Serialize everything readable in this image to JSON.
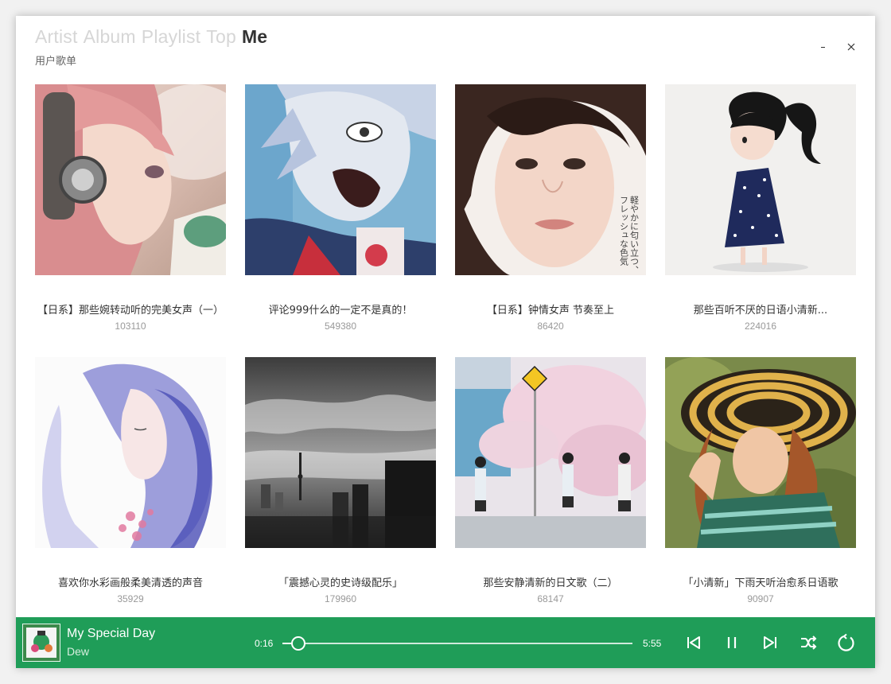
{
  "nav": {
    "tabs": [
      {
        "label": "Artist",
        "active": false
      },
      {
        "label": "Album",
        "active": false
      },
      {
        "label": "Playlist",
        "active": false
      },
      {
        "label": "Top",
        "active": false
      },
      {
        "label": "Me",
        "active": true
      }
    ],
    "subtitle": "用户歌单"
  },
  "window_controls": {
    "minimize_icon": "minimize-icon",
    "close_icon": "close-icon"
  },
  "playlists": [
    {
      "title": "【日系】那些婉转动听的完美女声（一）",
      "count": "103110",
      "cover": "anime-girl-headphones"
    },
    {
      "title": "评论999什么的一定不是真的！",
      "count": "549380",
      "cover": "anime-boy-shouting"
    },
    {
      "title": "【日系】钟情女声 节奏至上",
      "count": "86420",
      "cover": "woman-portrait"
    },
    {
      "title": "那些百听不厌的日语小清新...",
      "count": "224016",
      "cover": "little-girl-sketch"
    },
    {
      "title": "喜欢你水彩画般柔美清透的声音",
      "count": "35929",
      "cover": "watercolor-woman"
    },
    {
      "title": "「震撼心灵的史诗级配乐」",
      "count": "179960",
      "cover": "city-skyline-bw"
    },
    {
      "title": "那些安静清新的日文歌（二）",
      "count": "68147",
      "cover": "cherry-blossom-street"
    },
    {
      "title": "「小清新」下雨天听治愈系日语歌",
      "count": "90907",
      "cover": "woman-straw-hat"
    }
  ],
  "cover_text": {
    "vertical_caption": "軽やかに匂い立つ、フレッシュな色気"
  },
  "player": {
    "title": "My Special Day",
    "artist": "Dew",
    "current_time": "0:16",
    "total_time": "5:55",
    "progress": 0.045,
    "accent_color": "#1f9d58",
    "icons": [
      "prev-icon",
      "pause-icon",
      "next-icon",
      "shuffle-icon",
      "repeat-icon"
    ]
  }
}
